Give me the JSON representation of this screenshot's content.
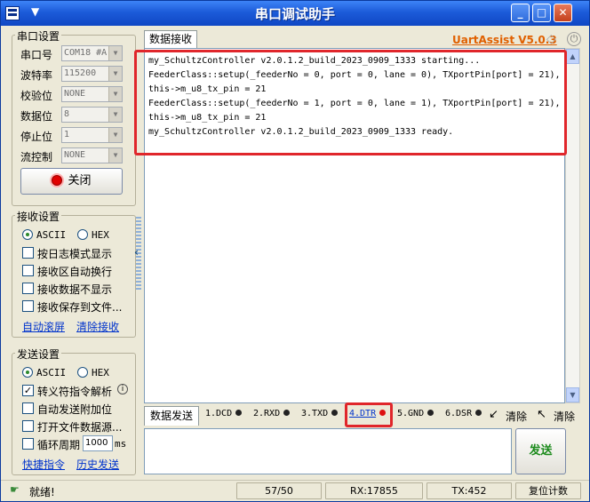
{
  "app": {
    "title": "串口调试助手",
    "brand": "UartAssist V5.0.3"
  },
  "serial": {
    "legend": "串口设置",
    "rows": [
      {
        "label": "串口号",
        "value": "COM18 #A"
      },
      {
        "label": "波特率",
        "value": "115200"
      },
      {
        "label": "校验位",
        "value": "NONE"
      },
      {
        "label": "数据位",
        "value": "8"
      },
      {
        "label": "停止位",
        "value": "1"
      },
      {
        "label": "流控制",
        "value": "NONE"
      }
    ],
    "close_label": "关闭"
  },
  "receive_settings": {
    "legend": "接收设置",
    "ascii": "ASCII",
    "hex": "HEX",
    "options": [
      "按日志模式显示",
      "接收区自动换行",
      "接收数据不显示",
      "接收保存到文件..."
    ],
    "links": [
      "自动滚屏",
      "清除接收"
    ]
  },
  "send_settings": {
    "legend": "发送设置",
    "ascii": "ASCII",
    "hex": "HEX",
    "escape": "转义符指令解析",
    "options": [
      "自动发送附加位",
      "打开文件数据源..."
    ],
    "loop_label": "循环周期",
    "loop_value": "1000",
    "loop_unit": "ms",
    "links": [
      "快捷指令",
      "历史发送"
    ]
  },
  "receive": {
    "tab": "数据接收",
    "lines": [
      "my_SchultzController v2.0.1.2_build_2023_0909_1333 starting...",
      "FeederClass::setup(_feederNo = 0, port = 0, lane = 0), TXportPin[port] = 21),",
      "this->m_u8_tx_pin = 21",
      "FeederClass::setup(_feederNo = 1, port = 0, lane = 1), TXportPin[port] = 21),",
      "this->m_u8_tx_pin = 21",
      "my_SchultzController v2.0.1.2_build_2023_0909_1333 ready."
    ]
  },
  "send": {
    "tab": "数据发送",
    "signals": [
      "1.DCD",
      "2.RXD",
      "3.TXD",
      "4.DTR",
      "5.GND",
      "6.DSR"
    ],
    "clear1": "清除",
    "clear2": "清除",
    "send_label": "发送"
  },
  "status": {
    "ready": "就绪!",
    "count": "57/50",
    "rx": "RX:17855",
    "tx": "TX:452",
    "reset": "复位计数"
  }
}
